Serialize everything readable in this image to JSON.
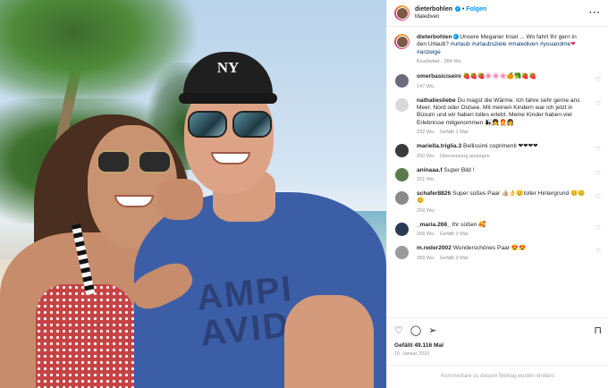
{
  "post": {
    "author": "dieterbohlen",
    "verified_mark": "✔",
    "follow_label": "Folgen",
    "location": "Malediven",
    "more_icon": "more-horizontal-icon",
    "photo_shirt_print": "AMPI\nAVID"
  },
  "caption": {
    "username": "dieterbohlen",
    "text": " Unsere Meganer Insel ... Wo fahrt Ihr gern in den Urlaub? ",
    "hashtags": "#urlaub #urlaubsziele #malediven #youandme",
    "heart": "❤",
    "hashtag2": "#anzeige",
    "meta": "Bearbeitet · 284 Wo."
  },
  "comments": [
    {
      "user": "omerbasiciseini",
      "text": " 🍓🍓🍓🌸🌸🌸🍊🥦🍓🍓",
      "time": "147 Wo.",
      "extra": ""
    },
    {
      "user": "nathaliesliebe",
      "text": " Du magst die Wärme. Ich fahre sehr gerne ans Meer. Nord oder Ostsee. Mit meinen Kindern war ich jetzt in Büsum und wir haben tolles erlebt. Meine Kinder haben viel Erlebnisse mitgenommen 👩‍👧👧🧑‍🦰👩",
      "time": "232 Wo.",
      "extra": "Gefällt 1 Mal"
    },
    {
      "user": "mariella.triglia.3",
      "text": " Bellissimi coprimenti ❤❤❤❤",
      "time": "250 Wo.",
      "extra": "Übersetzung anzeigen"
    },
    {
      "user": "aninaaa.f",
      "text": " Super Bild !",
      "time": "251 Wo.",
      "extra": ""
    },
    {
      "user": "schafer8826",
      "text": " Super süßes Paar 👍🏼👌😊toller Hintergrund 😊😊😊",
      "time": "256 Wo.",
      "extra": ""
    },
    {
      "user": "_maria.268_",
      "text": " Ihr süßen 🥰",
      "time": "256 Wo.",
      "extra": "Gefällt 2 Mal"
    },
    {
      "user": "m.reder2002",
      "text": " Wunderschönes Paar 😍😍",
      "time": "259 Wo.",
      "extra": "Gefällt 2 Mal"
    }
  ],
  "actions": {
    "like_icon": "♡",
    "comment_icon": "◯",
    "share_icon": "➢",
    "save_icon": "⊓",
    "likes": "Gefällt 49.116 Mal",
    "date": "10. Januar 2019"
  },
  "comments_limited": "Kommentare zu diesem Beitrag wurden limitiert."
}
